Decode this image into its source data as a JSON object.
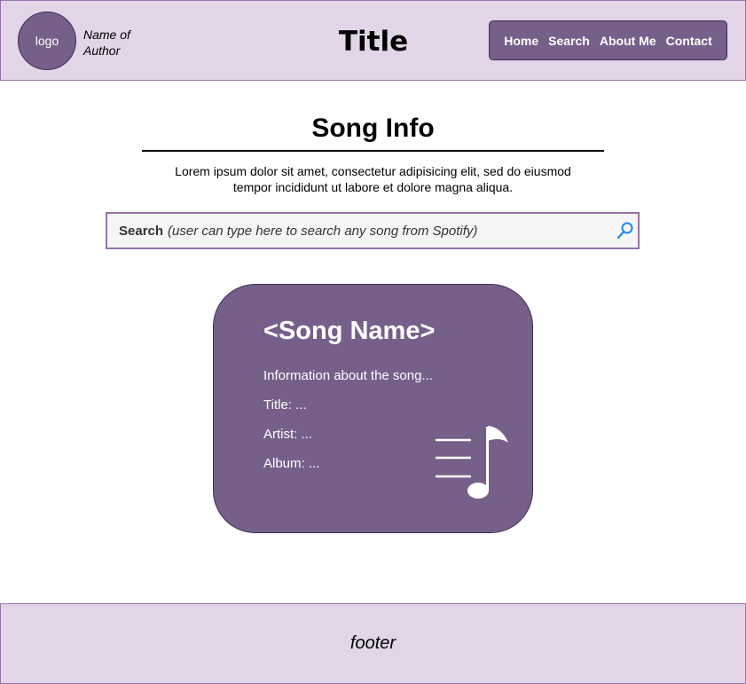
{
  "header": {
    "logo_label": "logo",
    "author_name": "Name of Author",
    "site_title": "Title",
    "nav": [
      {
        "label": "Home"
      },
      {
        "label": "Search"
      },
      {
        "label": "About Me"
      },
      {
        "label": "Contact"
      }
    ]
  },
  "main": {
    "heading": "Song Info",
    "intro": "Lorem ipsum dolor sit amet, consectetur adipisicing elit, sed do eiusmod tempor incididunt ut labore et dolore magna aliqua.",
    "search": {
      "label": "Search",
      "placeholder": "(user can type here to search any song from Spotify)",
      "icon": "search-icon"
    },
    "card": {
      "song_name": "<Song Name>",
      "info": "Information about the song...",
      "title_line": "Title: ...",
      "artist_line": "Artist: ...",
      "album_line": "Album: ...",
      "icon": "music-note-list-icon"
    }
  },
  "footer": {
    "text": "footer"
  },
  "colors": {
    "header_bg": "#e1d5e7",
    "header_border": "#9673a6",
    "accent": "#76608a",
    "accent_border": "#432d57",
    "search_icon": "#1e88e5"
  }
}
